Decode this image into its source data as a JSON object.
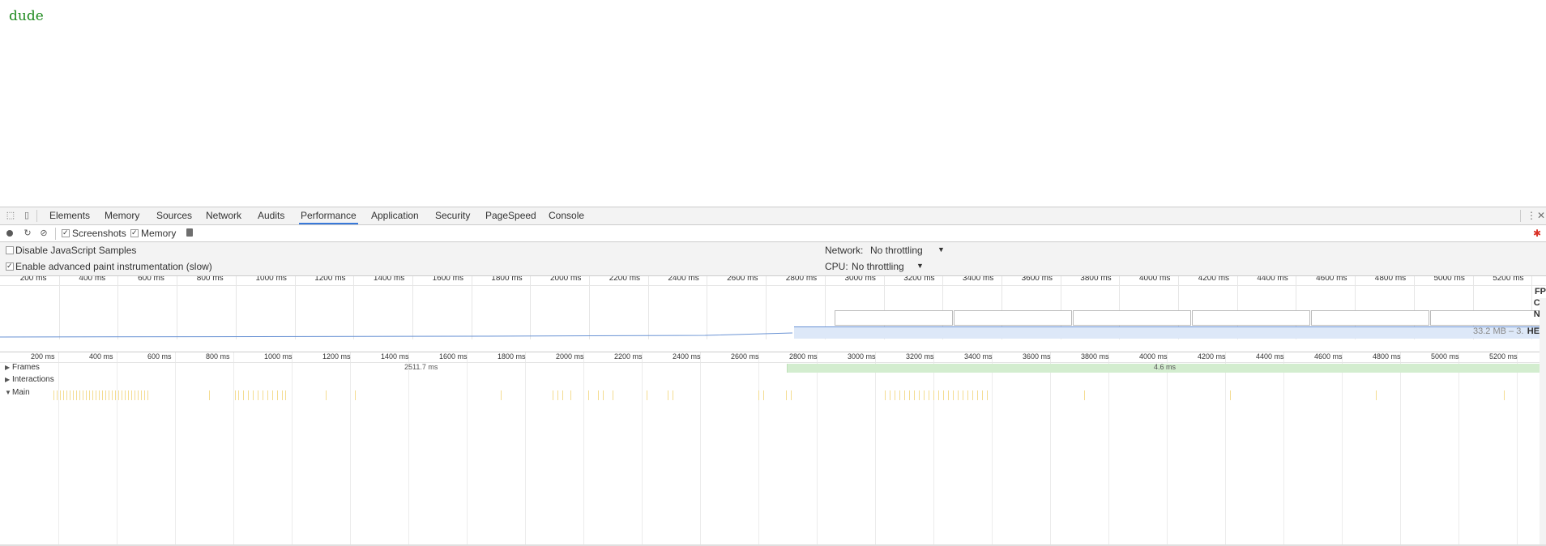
{
  "page": {
    "text": "dude"
  },
  "devtools": {
    "tabs": [
      "Elements",
      "Memory",
      "Sources",
      "Network",
      "Audits",
      "Performance",
      "Application",
      "Security",
      "PageSpeed",
      "Console"
    ],
    "active_tab": "Performance",
    "toolbar": {
      "screenshots_label": "Screenshots",
      "screenshots_checked": true,
      "memory_label": "Memory",
      "memory_checked": true
    },
    "settings": {
      "disable_js_samples_label": "Disable JavaScript Samples",
      "disable_js_samples_checked": false,
      "advanced_paint_label": "Enable advanced paint instrumentation (slow)",
      "advanced_paint_checked": true,
      "network_label": "Network:",
      "network_value": "No throttling",
      "cpu_label": "CPU:",
      "cpu_value": "No throttling"
    },
    "overview": {
      "ticks": [
        "200 ms",
        "400 ms",
        "600 ms",
        "800 ms",
        "1000 ms",
        "1200 ms",
        "1400 ms",
        "1600 ms",
        "1800 ms",
        "2000 ms",
        "2200 ms",
        "2400 ms",
        "2600 ms",
        "2800 ms",
        "3000 ms",
        "3200 ms",
        "3400 ms",
        "3600 ms",
        "3800 ms",
        "4000 ms",
        "4200 ms",
        "4400 ms",
        "4600 ms",
        "4800 ms",
        "5000 ms",
        "5200 ms"
      ],
      "side_labels": [
        "FP",
        "CP",
        "NE",
        "HEA"
      ],
      "heap_text": "33.2 MB – 3."
    },
    "timeline": {
      "ticks": [
        "200 ms",
        "400 ms",
        "600 ms",
        "800 ms",
        "1000 ms",
        "1200 ms",
        "1400 ms",
        "1600 ms",
        "1800 ms",
        "2000 ms",
        "2200 ms",
        "2400 ms",
        "2600 ms",
        "2800 ms",
        "3000 ms",
        "3200 ms",
        "3400 ms",
        "3600 ms",
        "3800 ms",
        "4000 ms",
        "4200 ms",
        "4400 ms",
        "4600 ms",
        "4800 ms",
        "5000 ms",
        "5200 ms"
      ],
      "tracks": {
        "frames": "Frames",
        "interactions": "Interactions",
        "main": "Main"
      },
      "frame_labels": [
        "2511.7 ms",
        "4.6 ms"
      ]
    }
  },
  "colors": {
    "accent": "#3879d9",
    "page_text": "#1e8a1e",
    "frames": "#d3edcf",
    "heap": "#dde8f8",
    "task": "#f4dc91"
  },
  "icons": [
    "inspect-icon",
    "device-toggle-icon",
    "record-icon",
    "reload-icon",
    "clear-icon",
    "trash-icon",
    "more-icon",
    "close-icon"
  ]
}
